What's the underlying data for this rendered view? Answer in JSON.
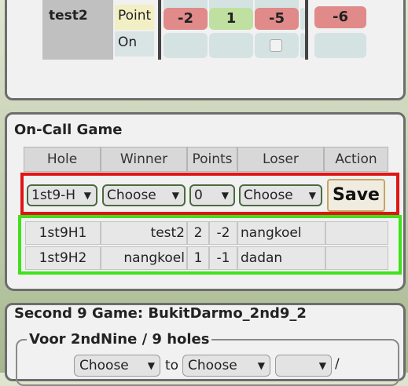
{
  "top": {
    "player": "test2",
    "point_label": "Point",
    "on_label": "On",
    "scores": [
      "-2",
      "1",
      "-5"
    ],
    "total": "-6"
  },
  "oncall": {
    "title": "On-Call Game",
    "headers": [
      "Hole",
      "Winner",
      "Points",
      "Loser",
      "Action"
    ],
    "input": {
      "hole": "1st9-H",
      "winner": "Choose",
      "points": "0",
      "loser": "Choose",
      "save": "Save"
    },
    "rows": [
      {
        "hole": "1st9H1",
        "winner": "test2",
        "p1": "2",
        "p2": "-2",
        "loser": "nangkoel"
      },
      {
        "hole": "1st9H2",
        "winner": "nangkoel",
        "p1": "1",
        "p2": "-1",
        "loser": "dadan"
      }
    ]
  },
  "second": {
    "title": "Second 9 Game: BukitDarmo_2nd9_2",
    "legend": "Voor 2ndNine / 9 holes",
    "from": "Choose",
    "to_label": "to",
    "to": "Choose",
    "slash": "/"
  },
  "icons": {
    "dropdown": "chevron-down-icon",
    "checkbox": "checkbox-icon"
  }
}
